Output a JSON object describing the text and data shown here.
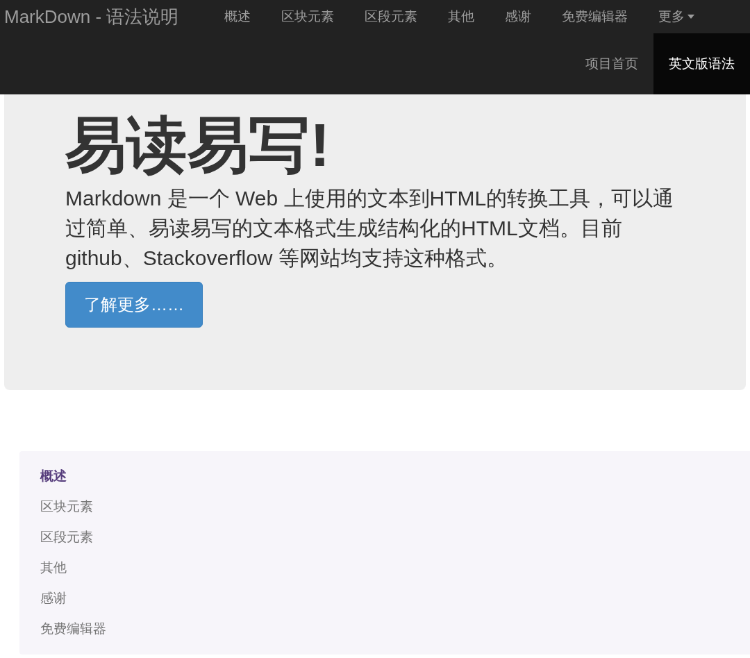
{
  "navbar": {
    "brand": "MarkDown - 语法说明",
    "items": [
      {
        "label": "概述",
        "kind": "link",
        "selected": false
      },
      {
        "label": "区块元素",
        "kind": "link",
        "selected": false
      },
      {
        "label": "区段元素",
        "kind": "link",
        "selected": false
      },
      {
        "label": "其他",
        "kind": "link",
        "selected": false
      },
      {
        "label": "感谢",
        "kind": "link",
        "selected": false
      },
      {
        "label": "免费编辑器",
        "kind": "link",
        "selected": false
      },
      {
        "label": "更多",
        "kind": "dropdown",
        "selected": false
      }
    ],
    "right_items": [
      {
        "label": "项目首页",
        "selected": false
      },
      {
        "label": "英文版语法",
        "selected": true
      }
    ]
  },
  "jumbotron": {
    "heading": "易读易写!",
    "paragraph": "Markdown 是一个 Web 上使用的文本到HTML的转换工具，可以通过简单、易读易写的文本格式生成结构化的HTML文档。目前 github、Stackoverflow 等网站均支持这种格式。",
    "button": "了解更多……"
  },
  "sidenav": {
    "items": [
      {
        "label": "概述",
        "selected": true
      },
      {
        "label": "区块元素",
        "selected": false
      },
      {
        "label": "区段元素",
        "selected": false
      },
      {
        "label": "其他",
        "selected": false
      },
      {
        "label": "感谢",
        "selected": false
      },
      {
        "label": "免费编辑器",
        "selected": false
      }
    ]
  }
}
